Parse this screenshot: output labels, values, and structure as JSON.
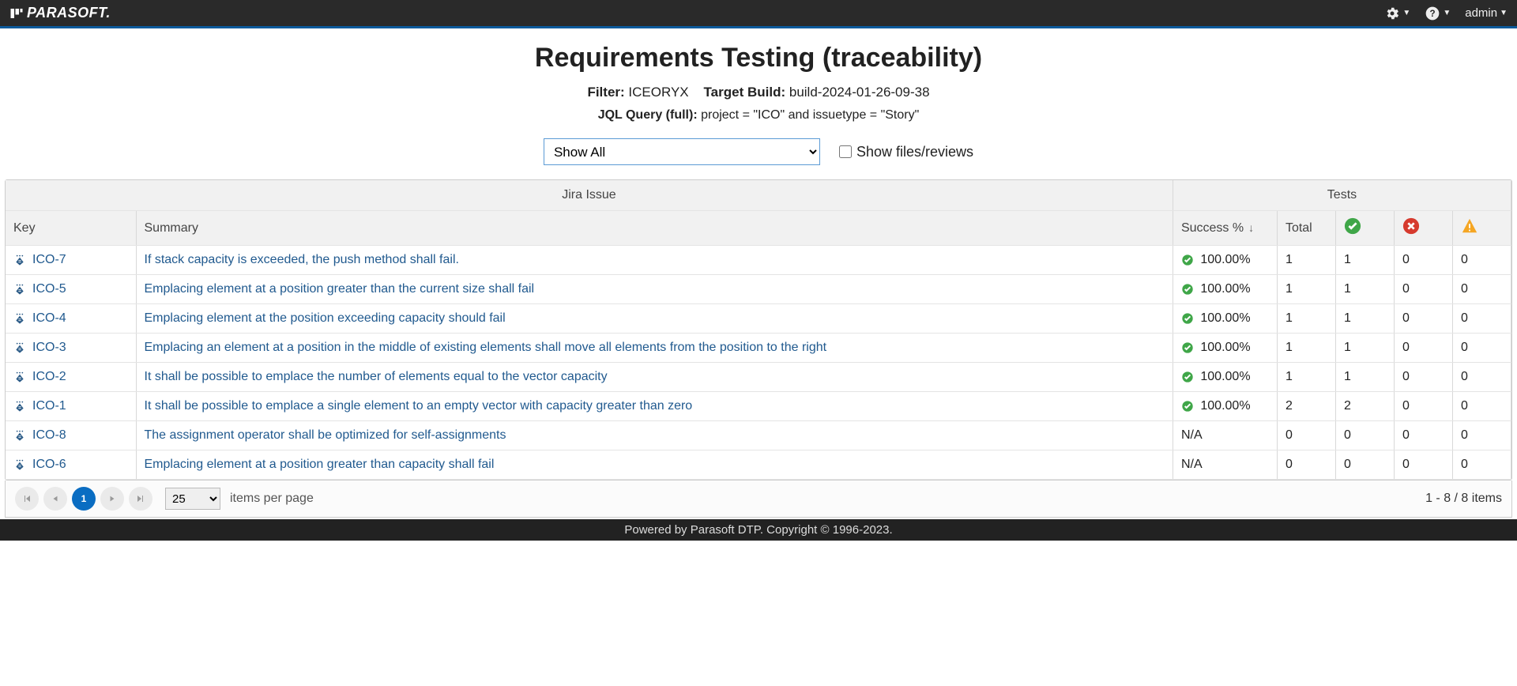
{
  "header": {
    "brand": "PARASOFT.",
    "user": "admin"
  },
  "page": {
    "title": "Requirements Testing (traceability)",
    "filter_label": "Filter:",
    "filter_value": "ICEORYX",
    "target_label": "Target Build:",
    "target_value": "build-2024-01-26-09-38",
    "jql_label": "JQL Query (full):",
    "jql_value": "project = \"ICO\" and issuetype = \"Story\""
  },
  "controls": {
    "show_select": "Show All",
    "show_files_label": "Show files/reviews"
  },
  "table": {
    "group_jira": "Jira Issue",
    "group_tests": "Tests",
    "col_key": "Key",
    "col_summary": "Summary",
    "col_success": "Success %",
    "col_total": "Total",
    "rows": [
      {
        "key": "ICO-7",
        "summary": "If stack capacity is exceeded, the push method shall fail.",
        "success": "100.00%",
        "has_icon": true,
        "total": "1",
        "pass": "1",
        "fail": "0",
        "warn": "0"
      },
      {
        "key": "ICO-5",
        "summary": "Emplacing element at a position greater than the current size shall fail",
        "success": "100.00%",
        "has_icon": true,
        "total": "1",
        "pass": "1",
        "fail": "0",
        "warn": "0"
      },
      {
        "key": "ICO-4",
        "summary": "Emplacing element at the position exceeding capacity should fail",
        "success": "100.00%",
        "has_icon": true,
        "total": "1",
        "pass": "1",
        "fail": "0",
        "warn": "0"
      },
      {
        "key": "ICO-3",
        "summary": "Emplacing an element at a position in the middle of existing elements shall move all elements from the position to the right",
        "success": "100.00%",
        "has_icon": true,
        "total": "1",
        "pass": "1",
        "fail": "0",
        "warn": "0"
      },
      {
        "key": "ICO-2",
        "summary": "It shall be possible to emplace the number of elements equal to the vector capacity",
        "success": "100.00%",
        "has_icon": true,
        "total": "1",
        "pass": "1",
        "fail": "0",
        "warn": "0"
      },
      {
        "key": "ICO-1",
        "summary": "It shall be possible to emplace a single element to an empty vector with capacity greater than zero",
        "success": "100.00%",
        "has_icon": true,
        "total": "2",
        "pass": "2",
        "fail": "0",
        "warn": "0"
      },
      {
        "key": "ICO-8",
        "summary": "The assignment operator shall be optimized for self-assignments",
        "success": "N/A",
        "has_icon": false,
        "total": "0",
        "pass": "0",
        "fail": "0",
        "warn": "0"
      },
      {
        "key": "ICO-6",
        "summary": "Emplacing element at a position greater than capacity shall fail",
        "success": "N/A",
        "has_icon": false,
        "total": "0",
        "pass": "0",
        "fail": "0",
        "warn": "0"
      }
    ]
  },
  "pager": {
    "page": "1",
    "page_size": "25",
    "ipp_label": "items per page",
    "range": "1 - 8 / 8 items"
  },
  "footer": {
    "text": "Powered by Parasoft DTP. Copyright © 1996-2023."
  }
}
